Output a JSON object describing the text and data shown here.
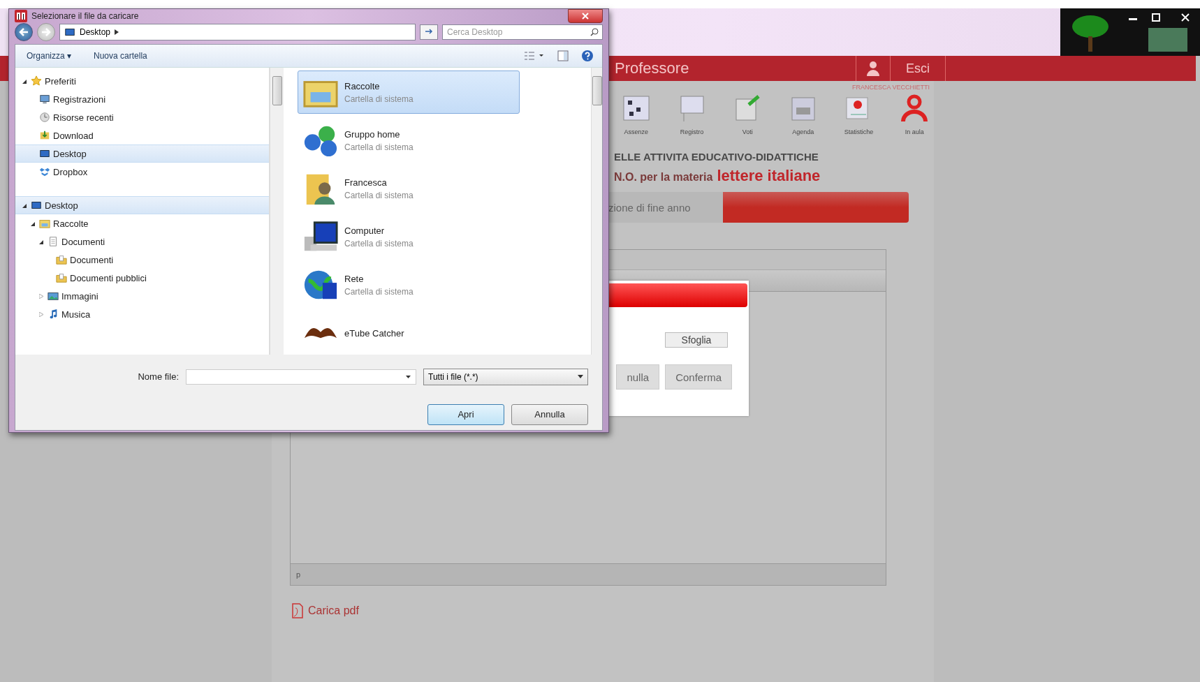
{
  "dialog": {
    "title": "Selezionare il file da caricare",
    "path": "Desktop",
    "search": {
      "placeholder": "Cerca Desktop"
    },
    "commands": [
      "Organizza ▾",
      "Nuova cartella"
    ],
    "tree": [
      {
        "label": "Preferiti",
        "kind": "star",
        "expanded": true,
        "selected": false,
        "children": [
          {
            "label": "Registrazioni",
            "kind": "screen",
            "selected": false
          },
          {
            "label": "Risorse recenti",
            "kind": "recent",
            "selected": false
          },
          {
            "label": "Download",
            "kind": "download",
            "selected": false
          },
          {
            "label": "Desktop",
            "kind": "desktop",
            "selected": true
          },
          {
            "label": "Dropbox",
            "kind": "dropbox",
            "selected": false
          }
        ]
      },
      {
        "label": "Desktop",
        "kind": "desktop",
        "expanded": true,
        "selected": true,
        "children": [
          {
            "label": "Raccolte",
            "kind": "library",
            "expanded": true,
            "selected": false,
            "children": [
              {
                "label": "Documenti",
                "kind": "document",
                "expanded": true,
                "selected": false,
                "children": [
                  {
                    "label": "Documenti",
                    "kind": "folder",
                    "selected": false
                  },
                  {
                    "label": "Documenti pubblici",
                    "kind": "folder",
                    "selected": false
                  }
                ]
              },
              {
                "label": "Immagini",
                "kind": "pictures",
                "expanded": false,
                "selected": false
              },
              {
                "label": "Musica",
                "kind": "music",
                "expanded": false,
                "selected": false
              }
            ]
          }
        ]
      }
    ],
    "files": [
      {
        "name": "Raccolte",
        "type": "Cartella di sistema",
        "kind": "library",
        "selected": true
      },
      {
        "name": "Gruppo home",
        "type": "Cartella di sistema",
        "kind": "homegroup",
        "selected": false
      },
      {
        "name": "Francesca",
        "type": "Cartella di sistema",
        "kind": "user",
        "selected": false
      },
      {
        "name": "Computer",
        "type": "Cartella di sistema",
        "kind": "computer",
        "selected": false
      },
      {
        "name": "Rete",
        "type": "Cartella di sistema",
        "kind": "network",
        "selected": false
      },
      {
        "name": "eTube Catcher",
        "kind": "app",
        "selected": false
      }
    ],
    "filename_label": "Nome file:",
    "filter": "Tutti i file (*.*)",
    "buttons": [
      {
        "label": "Apri",
        "kind": "default"
      },
      {
        "label": "Annulla",
        "kind": "normal"
      }
    ]
  },
  "app": {
    "title": "Professore",
    "logout": "Esci",
    "user": "FRANCESCA VECCHIETTI",
    "toolbar": [
      "Assenze",
      "Registro",
      "Voti",
      "Agenda",
      "Statistiche",
      "In aula"
    ],
    "heading": "ELLE ATTIVITA EDUCATIVO-DIDATTICHE",
    "subheading": "N.O. per la materia",
    "subject": "lettere italiane",
    "tab": "zione di fine anno",
    "modal": {
      "browse": "Sfoglia",
      "buttons": [
        "nulla",
        "Conferma"
      ]
    },
    "panel_footer": "p",
    "upload": "Carica pdf"
  }
}
